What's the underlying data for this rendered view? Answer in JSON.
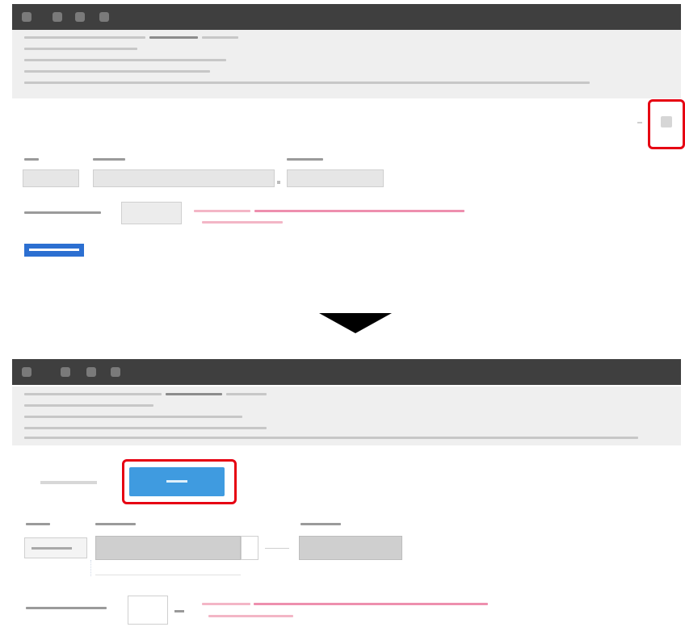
{
  "before": {
    "toolbar_icons": [
      "app-icon",
      "tool-icon",
      "settings-icon",
      "info-icon"
    ],
    "info_button_label": "",
    "blue_button_label": ""
  },
  "after": {
    "toolbar_icons": [
      "app-icon",
      "tool-icon",
      "settings-icon",
      "info-icon"
    ],
    "cancel_label": "",
    "primary_button_label": ""
  },
  "colors": {
    "toolbar": "#3f3f3f",
    "notes_bg": "#efefef",
    "highlight": "#e60012",
    "primary_blue": "#3f9be0",
    "blue_selected": "#2c6fd1",
    "pink_text": "#ee8fae"
  }
}
